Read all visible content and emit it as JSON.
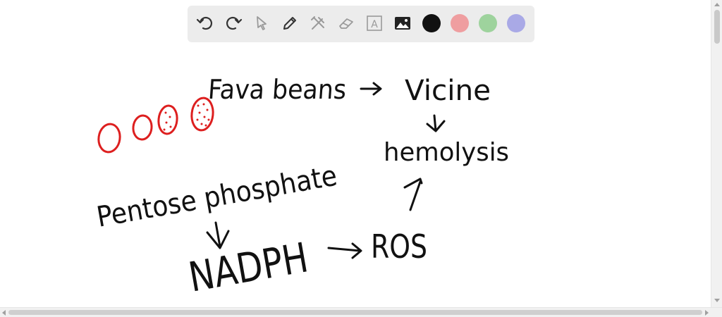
{
  "toolbar": {
    "tools": [
      {
        "name": "undo-button",
        "icon": "undo-icon"
      },
      {
        "name": "redo-button",
        "icon": "redo-icon"
      },
      {
        "name": "select-button",
        "icon": "pointer-icon"
      },
      {
        "name": "pen-button",
        "icon": "pencil-icon"
      },
      {
        "name": "tools-button",
        "icon": "tools-icon"
      },
      {
        "name": "eraser-button",
        "icon": "eraser-icon"
      },
      {
        "name": "text-button",
        "icon": "text-box-icon"
      },
      {
        "name": "image-button",
        "icon": "image-icon"
      }
    ],
    "colors": [
      "#111111",
      "#ef9ea0",
      "#9ed39d",
      "#a9a9e6"
    ],
    "text_tool_glyph": "A"
  },
  "canvas": {
    "ink_black": "#111111",
    "ink_red": "#dd1f1f",
    "texts": {
      "fava": "Fava beans",
      "vicine": "Vicine",
      "hemolysis": "hemolysis",
      "pentose": "Pentose phosphate",
      "nadph": "NADPH",
      "ros": "ROS"
    }
  }
}
